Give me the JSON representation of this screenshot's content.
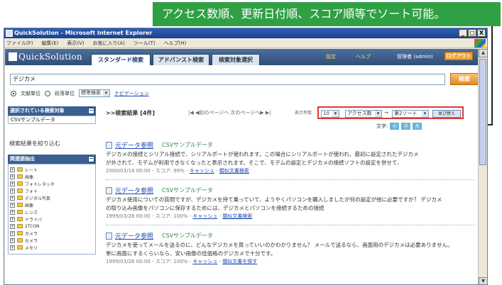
{
  "callout": {
    "text": "アクセス数順、更新日付順、スコア順等でソート可能。"
  },
  "window": {
    "title": "QuickSolution - Microsoft Internet Explorer",
    "buttons": [
      "_",
      "□",
      "X"
    ],
    "menu": [
      "ファイル(F)",
      "編集(E)",
      "表示(V)",
      "お気に入り(A)",
      "ツール(T)",
      "ヘルプ(H)"
    ]
  },
  "header": {
    "logo": "QuickSolution",
    "tabs": [
      "スタンダード検索",
      "アドバンスト検索",
      "検索対象選択"
    ],
    "links": [
      "設定",
      "ヘルプ"
    ],
    "user": "管理者 (admin)",
    "logout": "ログアウト"
  },
  "search": {
    "query": "デジカメ",
    "button": "検索",
    "radios": [
      "文献単位",
      "段落単位"
    ],
    "mode_select": "標準検索",
    "suggest": "ナビゲーション"
  },
  "sidebar": {
    "selected_title": "選択されている検索対象",
    "selected_item": "CSVサンプルデータ",
    "narrow": "検索結果を絞り込む",
    "related_title": "関連語抽出",
    "tree_items": [
      "レート",
      "画像",
      "フォトレタッチ",
      "フォト",
      "デジタル写真",
      "画像",
      "レンズ",
      "ドライバ",
      "2TCON",
      "カメラ",
      "カメラ",
      "メモリ"
    ]
  },
  "results": {
    "summary_label": ">>検索結果 [4件]",
    "pager": "|◀ ◀前のページへ 次のページへ▶ ▶|",
    "count_label": "表示件数",
    "count_value": "10",
    "sort1": "アクセス数",
    "sort2": "第2ソート",
    "arrow": "→",
    "sort_button": "並び替え",
    "text_size_label": "文字:",
    "text_sizes": [
      "小",
      "中",
      "大"
    ],
    "items": [
      {
        "title": "元データ参照",
        "category": "CSVサンプルデータ",
        "snippet1": "デジカメの接続とシリアル接続で、シリアルポートが使われます。この場合にシリアルポートが使われ、最初に設定されたデジカメ",
        "snippet2": "が外されて、モデムが利用できなくなったと表示されます。そこで、モデムの設定とデジカメの接続ソフトの設定を併せて、",
        "date": "2000/03/14 00:00",
        "score": "スコア: 99%",
        "cache": "キャッシュ",
        "similar": "類似文書検索"
      },
      {
        "title": "元データ参照",
        "category": "CSVサンプルデータ",
        "snippet1": "デジカメ使用についての質問ですが、デジカメを持て乗っていて、ようやくパソコンを購入しましたが何の設定が他に必要ですか？ デジカメ",
        "snippet2": "の取り込み画像をパソコンに保存するためには、デジカメとパソコンを接続するための接続",
        "date": "1999/03/28 00:00",
        "score": "スコア: 100%",
        "cache": "キャッシュ",
        "similar": "類似文書検索"
      },
      {
        "title": "元データ参照",
        "category": "CSVサンプルデータ",
        "snippet1": "デジカメを使ってメールを送るのに、どんなデジカメを買っていいのかわかりません？ メールで送るなら、画面用のデジカメは必要ありません。",
        "snippet2": "単に画面にするくらいなら、安い画像の低価格のデジカメで十分です。",
        "date": "1999/03/28 00:00",
        "score": "スコア: 100%",
        "cache": "キャッシュ",
        "similar": "類似文書を探す"
      }
    ]
  }
}
